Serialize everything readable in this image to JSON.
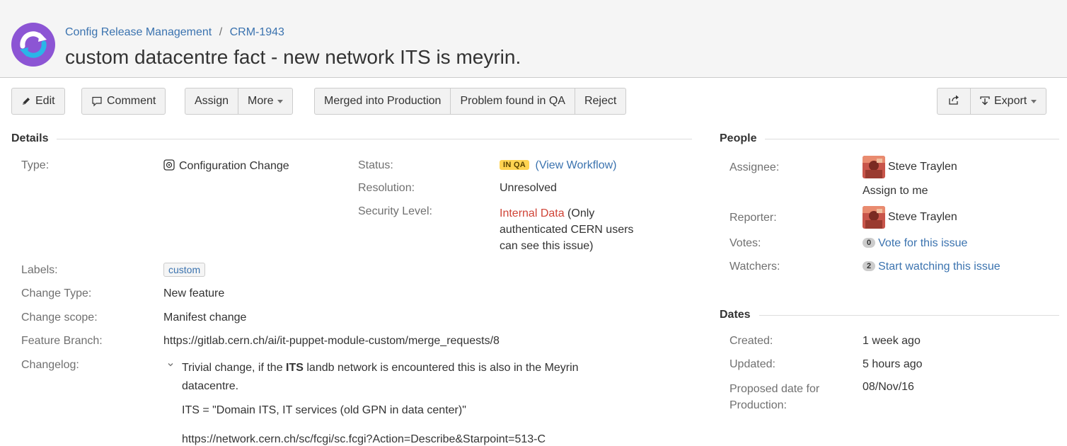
{
  "header": {
    "breadcrumb_project": "Config Release Management",
    "breadcrumb_separator": "/",
    "breadcrumb_issue_key": "CRM-1943",
    "title": "custom datacentre fact - new network ITS is meyrin."
  },
  "toolbar": {
    "edit": "Edit",
    "comment": "Comment",
    "assign": "Assign",
    "more": "More",
    "merged": "Merged into Production",
    "problem": "Problem found in QA",
    "reject": "Reject",
    "export": "Export"
  },
  "details": {
    "heading": "Details",
    "type_label": "Type:",
    "type_value": "Configuration Change",
    "status_label": "Status:",
    "status_value": "IN QA",
    "view_workflow": "(View Workflow)",
    "resolution_label": "Resolution:",
    "resolution_value": "Unresolved",
    "security_label": "Security Level:",
    "security_value": "Internal Data",
    "security_note_1": " (Only",
    "security_note_2": "authenticated CERN users",
    "security_note_3": "can see this issue)",
    "labels_label": "Labels:",
    "labels_value": "custom",
    "change_type_label": "Change Type:",
    "change_type_value": "New feature",
    "change_scope_label": "Change scope:",
    "change_scope_value": "Manifest change",
    "feature_branch_label": "Feature Branch:",
    "feature_branch_value": "https://gitlab.cern.ch/ai/it-puppet-module-custom/merge_requests/8",
    "changelog_label": "Changelog:",
    "changelog_line1_a": "Trivial change, if the ",
    "changelog_line1_b": "ITS",
    "changelog_line1_c": " landb network is encountered this is also in the Meyrin",
    "changelog_line2": "datacentre.",
    "changelog_line3": "ITS = \"Domain ITS, IT services (old GPN in data center)\"",
    "changelog_link": "https://network.cern.ch/sc/fcgi/sc.fcgi?Action=Describe&Starpoint=513-C"
  },
  "people": {
    "heading": "People",
    "assignee_label": "Assignee:",
    "assignee_value": "Steve Traylen",
    "assign_to_me": "Assign to me",
    "reporter_label": "Reporter:",
    "reporter_value": "Steve Traylen",
    "votes_label": "Votes:",
    "votes_count": "0",
    "votes_link": "Vote for this issue",
    "watchers_label": "Watchers:",
    "watchers_count": "2",
    "watchers_link": "Start watching this issue"
  },
  "dates": {
    "heading": "Dates",
    "created_label": "Created:",
    "created_value": "1 week ago",
    "updated_label": "Updated:",
    "updated_value": "5 hours ago",
    "proposed_label_1": "Proposed date for",
    "proposed_label_2": "Production:",
    "proposed_value": "08/Nov/16"
  },
  "colors": {
    "link": "#3b73af",
    "status_lozenge": "#ffd351",
    "security_red": "#d04437",
    "project_avatar": "#8c55d4"
  },
  "icons": {
    "project_avatar": "circular-arrows-project-icon",
    "edit": "pencil-icon",
    "comment": "speech-bubble-icon",
    "share": "share-icon",
    "export": "export-icon",
    "type": "configuration-change-icon",
    "changelog_toggle": "chevron-down-icon"
  }
}
